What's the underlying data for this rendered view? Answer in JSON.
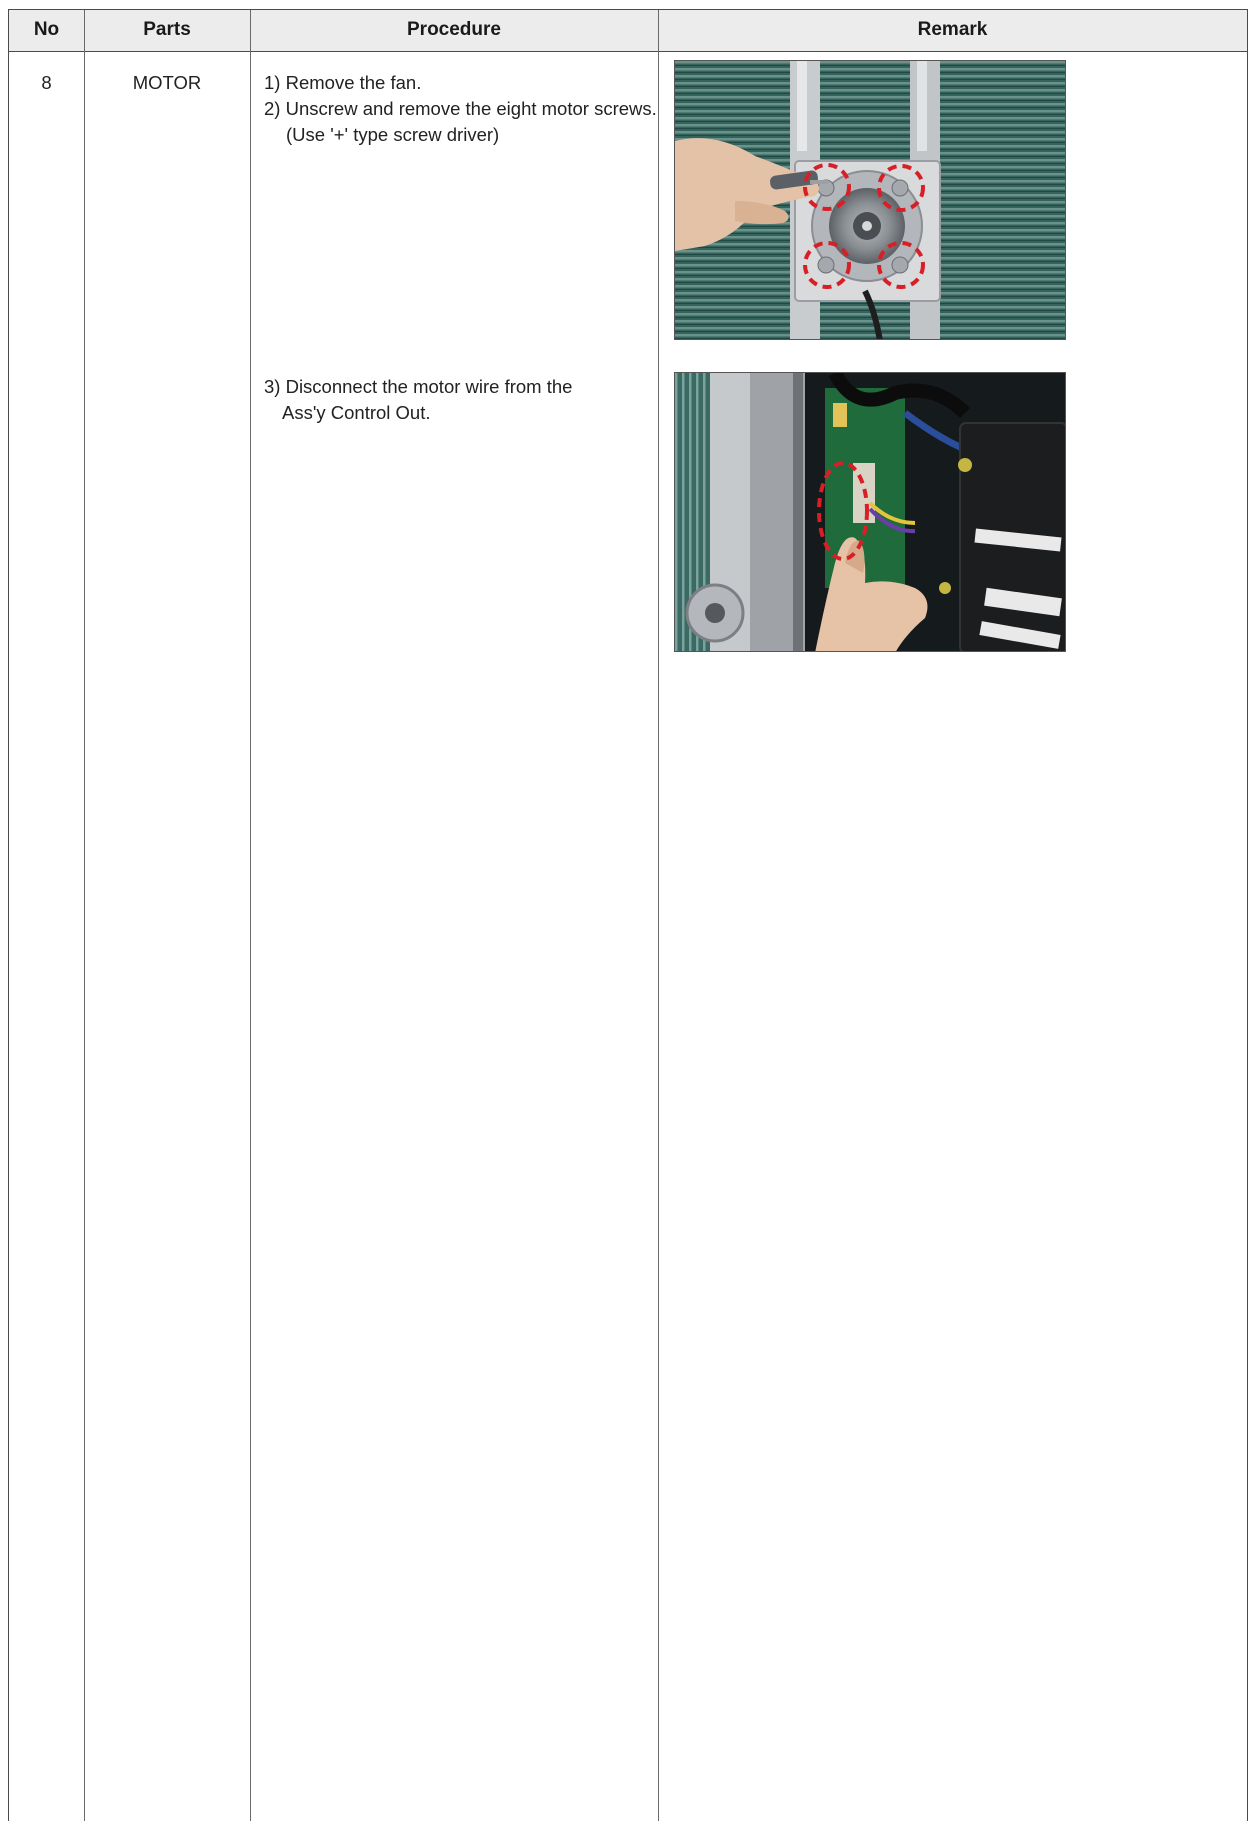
{
  "table": {
    "headers": {
      "no": "No",
      "parts": "Parts",
      "procedure": "Procedure",
      "remark": "Remark"
    },
    "row": {
      "no": "8",
      "part": "MOTOR",
      "steps": [
        {
          "line1": "1) Remove the fan.",
          "line2": ""
        },
        {
          "line1": "2) Unscrew and remove the eight motor screws.",
          "line2": "(Use '+' type screw driver)"
        },
        {
          "line1": "3) Disconnect the motor wire from the",
          "line2": "Ass'y Control Out."
        }
      ]
    }
  },
  "remark_photos": [
    {
      "name": "motor-screws-photo",
      "highlight_color": "#d81f26"
    },
    {
      "name": "motor-wire-connector-photo",
      "highlight_color": "#d81f26"
    }
  ]
}
